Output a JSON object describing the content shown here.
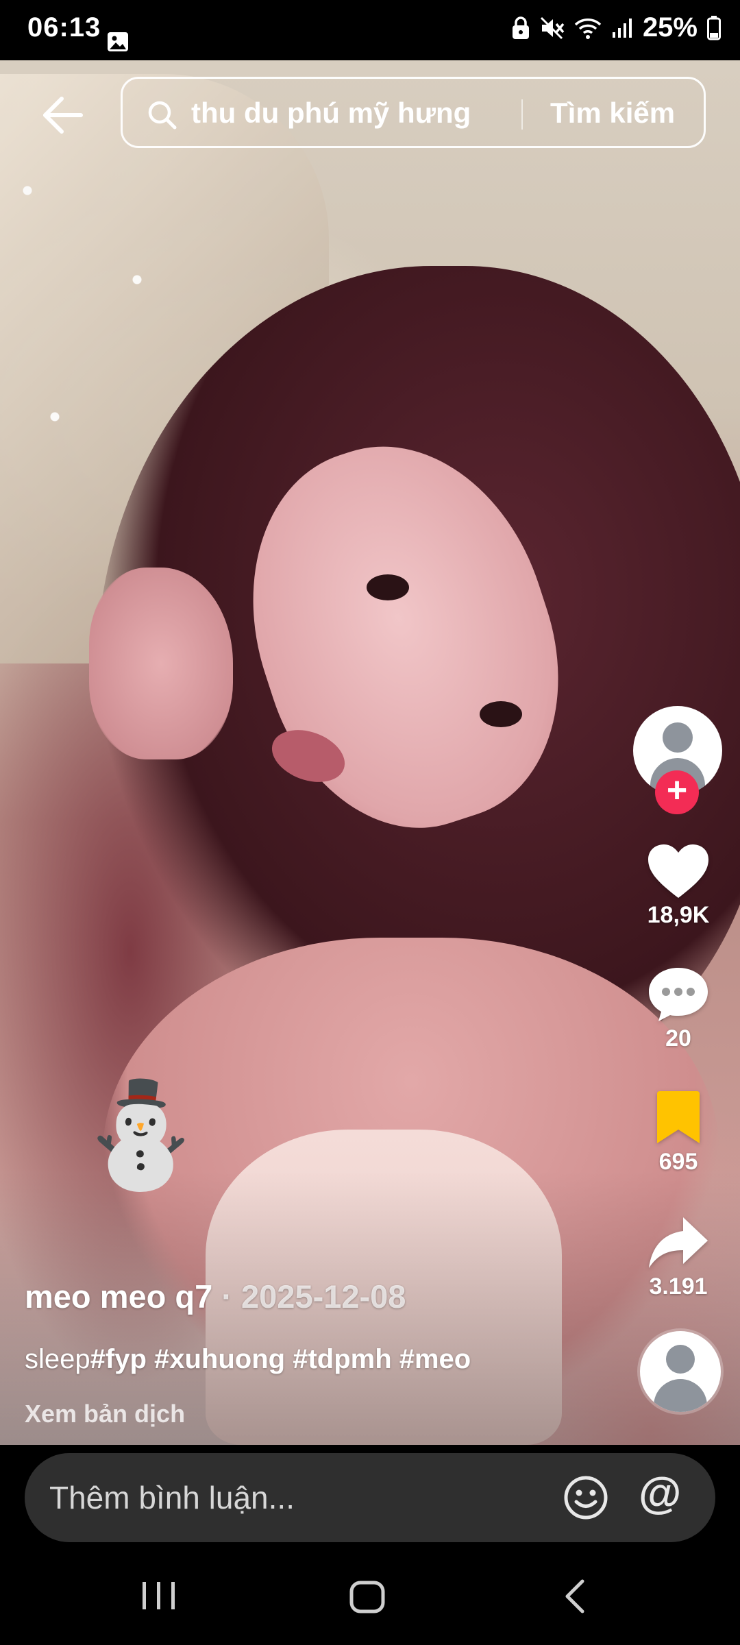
{
  "status_bar": {
    "time": "06:13",
    "battery": "25%",
    "icons": [
      "gallery-icon",
      "lock-icon",
      "mute-icon",
      "wifi-icon",
      "signal-icon",
      "battery-icon"
    ]
  },
  "search": {
    "query": "thu du phú mỹ hưng",
    "button_label": "Tìm kiếm"
  },
  "actions": {
    "likes": "18,9K",
    "comments": "20",
    "saves": "695",
    "shares": "3.191"
  },
  "post": {
    "author": "meo meo q7",
    "separator": " · ",
    "date": "2025-12-08",
    "caption_plain": "sleep",
    "caption_tags": "#fyp #xuhuong #tdpmh #meo",
    "translate_label": "Xem bản dịch",
    "sticker": "⛄"
  },
  "comment": {
    "placeholder": "Thêm bình luận...",
    "mention_symbol": "@"
  },
  "colors": {
    "follow_red": "#f32c55",
    "save_yellow": "#ffc300",
    "comment_bar": "#2f2f2f"
  }
}
